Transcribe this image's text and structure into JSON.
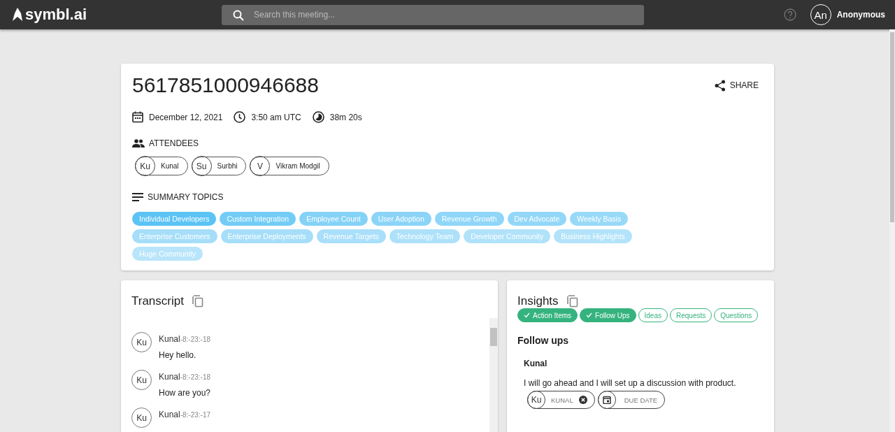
{
  "top_bar": {
    "logo": "symbl.ai",
    "search": {
      "placeholder": "Search this meeting..."
    },
    "user": {
      "initials": "An",
      "name": "Anonymous"
    }
  },
  "meeting": {
    "title": "5617851000946688",
    "share": "SHARE",
    "date": "December 12, 2021",
    "time": "3:50 am UTC",
    "duration": "38m 20s",
    "attendees_label": "ATTENDEES",
    "attendees": [
      {
        "initials": "Ku",
        "name": "Kunal"
      },
      {
        "initials": "Su",
        "name": "Surbhi"
      },
      {
        "initials": "V",
        "name": "Vikram Modgil"
      }
    ],
    "topics_label": "SUMMARY TOPICS",
    "topics": [
      {
        "label": "Individual Developers",
        "color": "#5cc3f5"
      },
      {
        "label": "Custom Integration",
        "color": "#73ccf6"
      },
      {
        "label": "Employee Count",
        "color": "#85d2f7"
      },
      {
        "label": "User Adoption",
        "color": "#8bd4f8"
      },
      {
        "label": "Revenue Growth",
        "color": "#8fd6f8"
      },
      {
        "label": "Dev Advocate",
        "color": "#93d7f8"
      },
      {
        "label": "Weekly Basis",
        "color": "#98d9f8"
      },
      {
        "label": "Enterprise Customers",
        "color": "#a6def9"
      },
      {
        "label": "Enterprise Deployments",
        "color": "#a6def9"
      },
      {
        "label": "Revenue Targets",
        "color": "#a9dffa"
      },
      {
        "label": "Technology Team",
        "color": "#ade1fa"
      },
      {
        "label": "Developer Community",
        "color": "#b0e2fa"
      },
      {
        "label": "Business Highlights",
        "color": "#b3e3fa"
      },
      {
        "label": "Huge Community",
        "color": "#b8e5fb"
      }
    ]
  },
  "transcript": {
    "title": "Transcript",
    "messages": [
      {
        "initials": "Ku",
        "speaker": "Kunal",
        "time": "-8:-23:-18",
        "text": "Hey hello."
      },
      {
        "initials": "Ku",
        "speaker": "Kunal",
        "time": "-8:-23:-18",
        "text": "How are you?"
      },
      {
        "initials": "Ku",
        "speaker": "Kunal",
        "time": "-8:-23:-17"
      }
    ]
  },
  "insights": {
    "title": "Insights",
    "filters": [
      {
        "label": "Action Items",
        "selected": true
      },
      {
        "label": "Follow Ups",
        "selected": true
      },
      {
        "label": "Ideas",
        "selected": false
      },
      {
        "label": "Requests",
        "selected": false
      },
      {
        "label": "Questions",
        "selected": false
      }
    ],
    "section_title": "Follow ups",
    "items": [
      {
        "speaker": "Kunal",
        "text": "I will go ahead and I will set up a discussion with product.",
        "assignee_initials": "Ku",
        "assignee": "KUNAL",
        "due_date": "DUE DATE"
      }
    ]
  }
}
